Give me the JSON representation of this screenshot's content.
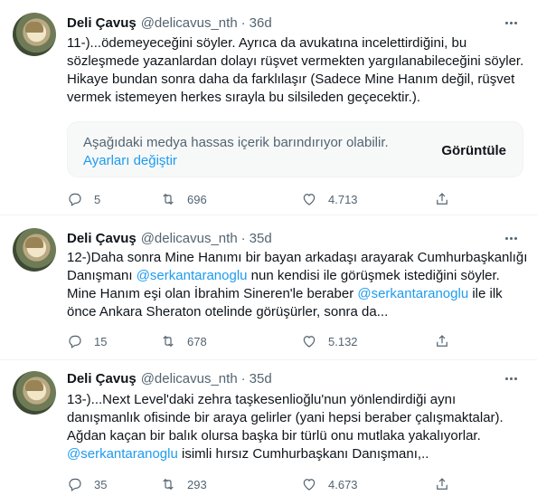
{
  "tweets": [
    {
      "name": "Deli Çavuş",
      "handle": "@delicavus_nth",
      "separator": "·",
      "time": "36d",
      "lines": [
        [
          {
            "t": "11-)...ödemeyeceğini söyler. Ayrıca da avukatına incelettirdiğini, bu"
          }
        ],
        [
          {
            "t": "sözleşmede yazanlardan dolayı rüşvet vermekten yargılanabileceğini söyler."
          }
        ],
        [
          {
            "t": "Hikaye bundan sonra daha da farklılaşır (Sadece Mine Hanım değil, rüşvet"
          }
        ],
        [
          {
            "t": "vermek istemeyen herkes sırayla bu silsileden geçecektir.)."
          }
        ]
      ],
      "media_warning": {
        "message": "Aşağıdaki medya hassas içerik barındırıyor olabilir.",
        "settings_link": "Ayarları değiştir",
        "view_button": "Görüntüle"
      },
      "stats": {
        "replies": "5",
        "retweets": "696",
        "likes": "4.713"
      }
    },
    {
      "name": "Deli Çavuş",
      "handle": "@delicavus_nth",
      "separator": "·",
      "time": "35d",
      "lines": [
        [
          {
            "t": "12-)Daha sonra Mine Hanımı bir bayan arkadaşı arayarak Cumhurbaşkanlığı"
          }
        ],
        [
          {
            "t": "Danışmanı "
          },
          {
            "t": "@serkantaranoglu",
            "m": true
          },
          {
            "t": " nun kendisi ile görüşmek istediğini söyler."
          }
        ],
        [
          {
            "t": "Mine Hanım eşi olan İbrahim Sineren'le beraber "
          },
          {
            "t": "@serkantaranoglu",
            "m": true
          },
          {
            "t": " ile ilk"
          }
        ],
        [
          {
            "t": "önce Ankara Sheraton otelinde görüşürler, sonra da..."
          }
        ]
      ],
      "stats": {
        "replies": "15",
        "retweets": "678",
        "likes": "5.132"
      }
    },
    {
      "name": "Deli Çavuş",
      "handle": "@delicavus_nth",
      "separator": "·",
      "time": "35d",
      "lines": [
        [
          {
            "t": "13-)...Next Level'daki zehra taşkesenlioğlu'nun yönlendirdiği aynı"
          }
        ],
        [
          {
            "t": "danışmanlık ofisinde bir araya gelirler (yani hepsi beraber çalışmaktalar)."
          }
        ],
        [
          {
            "t": "Ağdan kaçan bir balık olursa başka bir türlü onu mutlaka yakalıyorlar."
          }
        ],
        [
          {
            "t": "@serkantaranoglu",
            "m": true
          },
          {
            "t": " isimli hırsız Cumhurbaşkanı Danışmanı,.."
          }
        ]
      ],
      "stats": {
        "replies": "35",
        "retweets": "293",
        "likes": "4.673"
      }
    }
  ],
  "icons": {
    "reply": "reply-icon",
    "retweet": "retweet-icon",
    "like": "heart-icon",
    "share": "share-icon",
    "more": "more-icon"
  },
  "colors": {
    "link": "#1d9bf0",
    "secondary": "#536471",
    "text": "#0f1419"
  }
}
